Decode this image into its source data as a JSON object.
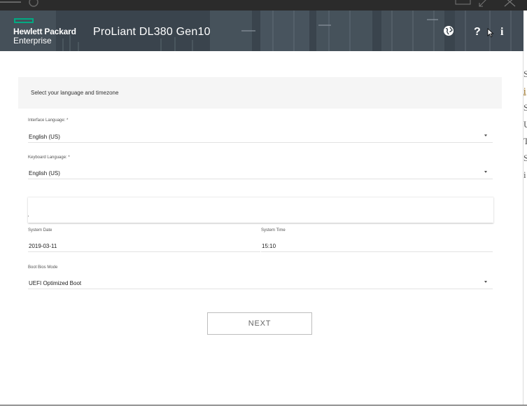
{
  "window": {
    "controls": [
      "restore",
      "resize",
      "close"
    ]
  },
  "header": {
    "brand_line1": "Hewlett Packard",
    "brand_line2": "Enterprise",
    "product_title": "ProLiant DL380 Gen10",
    "icons": [
      "globe-icon",
      "help-icon",
      "info-icon"
    ],
    "help_glyph": "?",
    "info_glyph": "i",
    "accent_color": "#01a982"
  },
  "background_text": [
    "S",
    "i",
    "S",
    "U",
    "T",
    "S",
    "i"
  ],
  "form": {
    "section_title": "Select your language and timezone",
    "interface_language": {
      "label": "Interface Language: *",
      "value": "English (US)"
    },
    "keyboard_language": {
      "label": "Keyboard Language: *",
      "value": "English (US)"
    },
    "system_date": {
      "label": "System Date",
      "value": "2019-03-11"
    },
    "system_time": {
      "label": "System Time",
      "value": "15:10"
    },
    "boot_mode": {
      "label": "Boot Bios Mode",
      "value": "UEFI Optimized Boot"
    },
    "next_label": "NEXT"
  }
}
